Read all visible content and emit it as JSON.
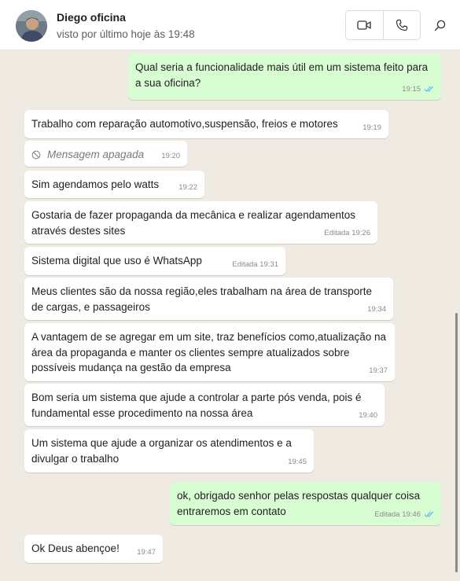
{
  "header": {
    "name": "Diego oficina",
    "status": "visto por último hoje às 19:48"
  },
  "messages": [
    {
      "dir": "out",
      "text": "Qual seria a funcionalidade mais útil em um sistema feito para a sua oficina?",
      "time": "19:15",
      "read": true
    },
    {
      "dir": "in",
      "text": "Trabalho com reparação automotivo,suspensão, freios e motores",
      "time": "19:19"
    },
    {
      "dir": "in",
      "text": "Mensagem apagada",
      "time": "19:20",
      "deleted": true
    },
    {
      "dir": "in",
      "text": "Sim agendamos pelo watts",
      "time": "19:22"
    },
    {
      "dir": "in",
      "text": "Gostaria de fazer propaganda da mecânica e realizar agendamentos através destes sites",
      "time": "Editada 19:26"
    },
    {
      "dir": "in",
      "text": "Sistema digital que uso é  WhatsApp",
      "time": "Editada 19:31"
    },
    {
      "dir": "in",
      "text": "Meus clientes são da nossa região,eles trabalham na área de transporte de cargas, e passageiros",
      "time": "19:34"
    },
    {
      "dir": "in",
      "text": "A vantagem de se agregar em um site, traz benefícios como,atualização na área da propaganda e manter os clientes sempre atualizados sobre possíveis mudança na gestão da empresa",
      "time": "19:37"
    },
    {
      "dir": "in",
      "text": "Bom seria um sistema que ajude a controlar a parte pós venda, pois é fundamental esse procedimento na nossa área",
      "time": "19:40"
    },
    {
      "dir": "in",
      "text": "Um sistema que ajude a organizar os atendimentos e a divulgar o trabalho",
      "time": "19:45"
    },
    {
      "dir": "out",
      "text": "ok, obrigado senhor pelas respostas qualquer coisa entraremos em contato",
      "time": "Editada 19:46",
      "read": true
    },
    {
      "dir": "in",
      "text": "Ok Deus abençoe!",
      "time": "19:47"
    }
  ],
  "colors": {
    "background": "#efeae2",
    "incoming": "#ffffff",
    "outgoing": "#d9fdd3",
    "read_ticks": "#53bdeb"
  },
  "icons": [
    "video-call-icon",
    "voice-call-icon",
    "search-icon",
    "read-ticks-icon",
    "deleted-message-icon"
  ]
}
